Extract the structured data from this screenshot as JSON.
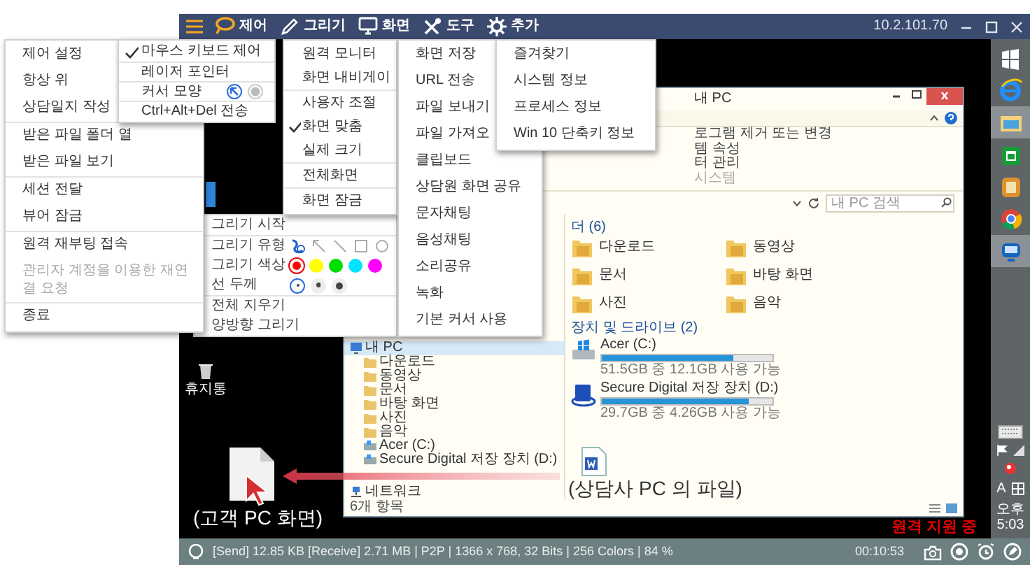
{
  "viewer": {
    "toolbar": [
      {
        "label": "제어"
      },
      {
        "label": "그리기"
      },
      {
        "label": "화면"
      },
      {
        "label": "도구"
      },
      {
        "label": "추가"
      }
    ],
    "address": "10.2.101.70"
  },
  "main_menu": {
    "groups": [
      [
        {
          "label": "제어 설정",
          "disabled": false
        },
        {
          "label": "항상 위",
          "disabled": false
        },
        {
          "label": "상담일지 작성",
          "disabled": false
        }
      ],
      [
        {
          "label": "받은 파일 폴더 열",
          "disabled": false
        },
        {
          "label": "받은 파일 보기",
          "disabled": false
        }
      ],
      [
        {
          "label": "세션 전달",
          "disabled": false
        },
        {
          "label": "뷰어 잠금",
          "disabled": false
        }
      ],
      [
        {
          "label": "원격 재부팅 접속",
          "disabled": false
        },
        {
          "label": "관리자 계정을 이용한 재연결 요청",
          "disabled": true
        }
      ],
      [
        {
          "label": "종료",
          "disabled": false
        }
      ]
    ]
  },
  "control_menu": {
    "items": [
      {
        "kind": "check",
        "label": "마우스 키보드 제어",
        "checked": true
      },
      {
        "kind": "check",
        "label": "레이저 포인터",
        "checked": false
      },
      {
        "kind": "cursor",
        "label": "커서 모양",
        "options": [
          {
            "selected": true
          },
          {
            "selected": false
          }
        ]
      },
      {
        "kind": "check",
        "label": "Ctrl+Alt+Del 전송",
        "checked": false
      }
    ]
  },
  "screen_menu": {
    "groups": [
      [
        {
          "label": "원격 모니터",
          "checked": false
        },
        {
          "label": "화면 내비게이",
          "checked": false
        }
      ],
      [
        {
          "label": "사용자 조절",
          "checked": false
        },
        {
          "label": "화면 맞춤",
          "checked": true
        },
        {
          "label": "실제 크기",
          "checked": false
        }
      ],
      [
        {
          "label": "전체화면",
          "checked": false
        }
      ],
      [
        {
          "label": "화면 잠금",
          "checked": false
        }
      ]
    ]
  },
  "tools_menu": {
    "items": [
      "화면 저장",
      "URL 전송",
      "파일 보내기",
      "파일 가져오",
      "클립보드",
      "상담원 화면 공유",
      "문자채팅",
      "음성채팅",
      "소리공유",
      "녹화",
      "기본 커서 사용"
    ]
  },
  "extra_menu": {
    "items": [
      "즐겨찾기",
      "시스템 정보",
      "프로세스 정보",
      "Win 10 단축키 정보"
    ]
  },
  "drawing_panel": {
    "rows": [
      {
        "kind": "action",
        "label": "그리기 시작"
      },
      {
        "kind": "tools",
        "label": "그리기 유형",
        "tools": [
          {
            "selected": true
          },
          {
            "selected": false
          },
          {
            "selected": false
          },
          {
            "selected": false
          },
          {
            "selected": false
          }
        ]
      },
      {
        "kind": "colors",
        "label": "그리기 색상",
        "colors": [
          {
            "color": "#ff0000",
            "selected": true
          },
          {
            "color": "#ffff00",
            "selected": false
          },
          {
            "color": "#00dd00",
            "selected": false
          },
          {
            "color": "#00e5ff",
            "selected": false
          },
          {
            "color": "#ff00ff",
            "selected": false
          }
        ]
      },
      {
        "kind": "thickness",
        "label": "선 두께",
        "options": [
          {
            "selected": true
          },
          {
            "selected": false
          },
          {
            "selected": false
          }
        ]
      },
      {
        "kind": "action",
        "label": "전체 지우기"
      },
      {
        "kind": "action",
        "label": "양방향 그리기"
      }
    ]
  },
  "desktop": {
    "recycle_label": "휴지통",
    "customer_caption": "(고객 PC 화면)",
    "status_badge": "원격 지원 중"
  },
  "explorer": {
    "title": "내 PC",
    "ribbon_lines": [
      "로그램 제거 또는 변경",
      "템 속성",
      "터 관리"
    ],
    "ribbon_group": "시스템",
    "search": {
      "placeholder": "내 PC 검색"
    },
    "nav": [
      {
        "kind": "pc",
        "label": "내 PC",
        "selected": true,
        "children": [
          {
            "kind": "folder",
            "label": "다운로드",
            "selected": false
          },
          {
            "kind": "folder",
            "label": "동영상",
            "selected": false
          },
          {
            "kind": "folder",
            "label": "문서",
            "selected": false
          },
          {
            "kind": "folder",
            "label": "바탕 화면",
            "selected": false
          },
          {
            "kind": "folder",
            "label": "사진",
            "selected": false
          },
          {
            "kind": "folder",
            "label": "음악",
            "selected": false
          },
          {
            "kind": "drive",
            "label": "Acer (C:)",
            "selected": false
          },
          {
            "kind": "drive",
            "label": "Secure Digital 저장 장치 (D:)",
            "selected": false
          }
        ]
      },
      {
        "kind": "network",
        "label": "네트워크",
        "selected": false
      }
    ],
    "folders_header": "더 (6)",
    "folders": [
      "다운로드",
      "동영상",
      "문서",
      "바탕 화면",
      "사진",
      "음악"
    ],
    "drives_header": "장치 및 드라이브 (2)",
    "drives": [
      {
        "kind": "disk",
        "name": "Acer (C:)",
        "level": 0.77,
        "free": "51.5GB 중 12.1GB 사용 가능"
      },
      {
        "kind": "sd",
        "name": "Secure Digital 저장 장치 (D:)",
        "level": 0.86,
        "free": "29.7GB 중 4.26GB 사용 가능"
      }
    ],
    "agent_caption": "(상담사 PC 의 파일)",
    "status": "6개 항목"
  },
  "taskbar": {
    "ime": "A",
    "time": "오후 5:03"
  },
  "status_bar": {
    "text": "[Send] 12.85 KB  [Receive] 2.71 MB | P2P | 1366 x 768, 32 Bits | 256 Colors | 84 %",
    "timer": "00:10:53"
  }
}
